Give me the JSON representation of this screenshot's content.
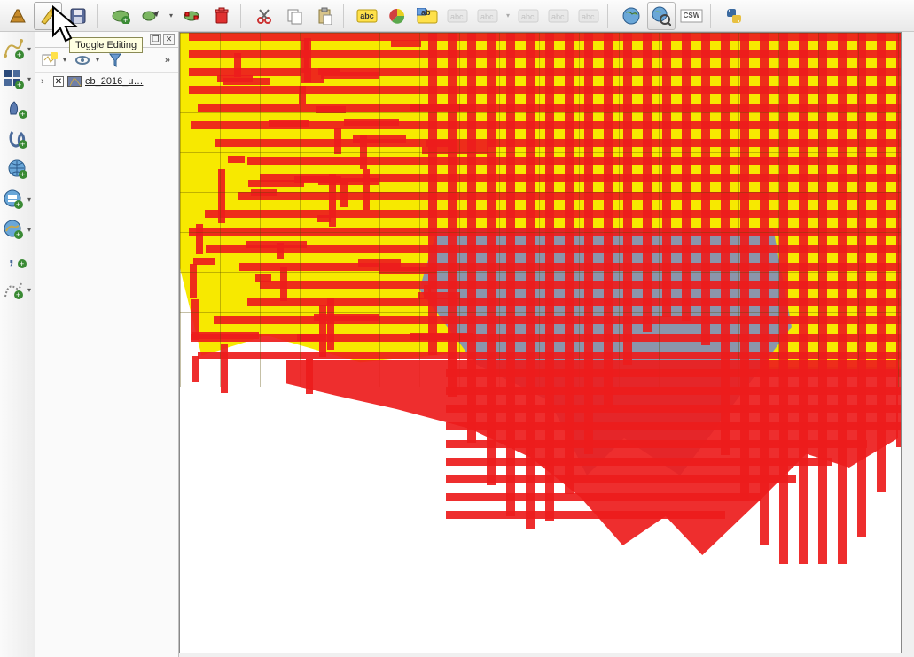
{
  "tooltip": {
    "text": "Toggle Editing"
  },
  "toolbar": {
    "edit_pencil": "✎",
    "save": "💾",
    "abc": "abc",
    "ab": "ab",
    "csw": "CSW"
  },
  "layers": {
    "items": [
      {
        "checked": true,
        "name": "cb_2016_u…"
      }
    ]
  },
  "ellipsis": "»"
}
